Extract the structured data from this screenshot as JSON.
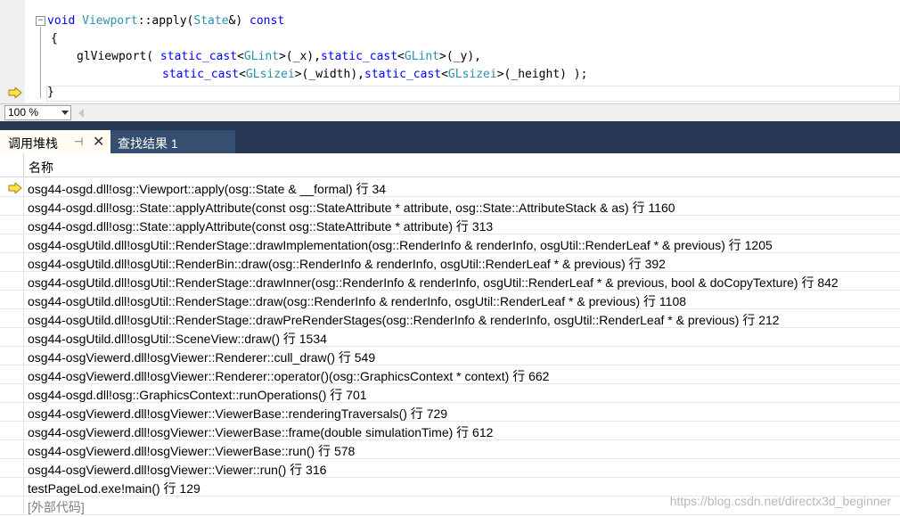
{
  "editor": {
    "line1": {
      "kw1": "void ",
      "ty1": "Viewport",
      "t1": "::apply(",
      "ty2": "State",
      "t2": "&) ",
      "kw2": "const"
    },
    "line2": "{",
    "line3": {
      "t1": "glViewport( ",
      "kw1": "static_cast",
      "t2": "<",
      "ty1": "GLint",
      "t3": ">(_x),",
      "kw2": "static_cast",
      "t4": "<",
      "ty2": "GLint",
      "t5": ">(_y),"
    },
    "line4": {
      "kw1": "static_cast",
      "t1": "<",
      "ty1": "GLsizei",
      "t2": ">(_width),",
      "kw2": "static_cast",
      "t3": "<",
      "ty2": "GLsizei",
      "t4": ">(_height) );"
    },
    "line5": "}"
  },
  "zoom": {
    "value": "100 %"
  },
  "tabs": {
    "active": "调用堆栈",
    "pin": "⊣",
    "close": "✕",
    "inactive": "查找结果 1"
  },
  "grid": {
    "header": "名称",
    "rows": [
      "osg44-osgd.dll!osg::Viewport::apply(osg::State & __formal) 行 34",
      "osg44-osgd.dll!osg::State::applyAttribute(const osg::StateAttribute * attribute, osg::State::AttributeStack & as) 行 1160",
      "osg44-osgd.dll!osg::State::applyAttribute(const osg::StateAttribute * attribute) 行 313",
      "osg44-osgUtild.dll!osgUtil::RenderStage::drawImplementation(osg::RenderInfo & renderInfo, osgUtil::RenderLeaf * & previous) 行 1205",
      "osg44-osgUtild.dll!osgUtil::RenderBin::draw(osg::RenderInfo & renderInfo, osgUtil::RenderLeaf * & previous) 行 392",
      "osg44-osgUtild.dll!osgUtil::RenderStage::drawInner(osg::RenderInfo & renderInfo, osgUtil::RenderLeaf * & previous, bool & doCopyTexture) 行 842",
      "osg44-osgUtild.dll!osgUtil::RenderStage::draw(osg::RenderInfo & renderInfo, osgUtil::RenderLeaf * & previous) 行 1108",
      "osg44-osgUtild.dll!osgUtil::RenderStage::drawPreRenderStages(osg::RenderInfo & renderInfo, osgUtil::RenderLeaf * & previous) 行 212",
      "osg44-osgUtild.dll!osgUtil::SceneView::draw() 行 1534",
      "osg44-osgViewerd.dll!osgViewer::Renderer::cull_draw() 行 549",
      "osg44-osgViewerd.dll!osgViewer::Renderer::operator()(osg::GraphicsContext * context) 行 662",
      "osg44-osgd.dll!osg::GraphicsContext::runOperations() 行 701",
      "osg44-osgViewerd.dll!osgViewer::ViewerBase::renderingTraversals() 行 729",
      "osg44-osgViewerd.dll!osgViewer::ViewerBase::frame(double simulationTime) 行 612",
      "osg44-osgViewerd.dll!osgViewer::ViewerBase::run() 行 578",
      "osg44-osgViewerd.dll!osgViewer::Viewer::run() 行 316",
      "testPageLod.exe!main() 行 129",
      "[外部代码]"
    ]
  },
  "watermark": "https://blog.csdn.net/directx3d_beginner"
}
